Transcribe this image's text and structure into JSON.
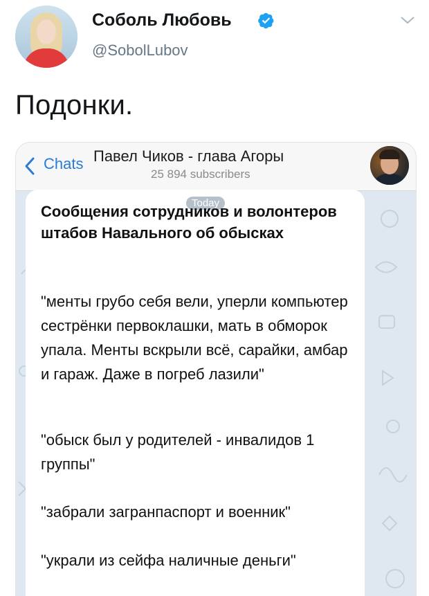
{
  "tweet": {
    "display_name": "Соболь Любовь",
    "handle": "@SobolLubov",
    "text": "Подонки.",
    "verified": true
  },
  "telegram": {
    "back_label": "Chats",
    "channel_title": "Павел Чиков - глава Агоры",
    "subscribers": "25 894 subscribers",
    "date_pill": "Today",
    "message": {
      "title": "Сообщения сотрудников и волонтеров штабов Навального об обысках",
      "paragraphs": [
        "\"менты грубо себя вели, уперли компьютер сестрёнки первоклашки, мать в обморок упала. Менты вскрыли всё, сарайки, амбар и гараж. Даже в погреб лазили\"",
        "\"обыск был у родителей - инвалидов 1 группы\"",
        "\"забрали загранпаспорт и военник\"",
        "\"украли из сейфа наличные деньги\""
      ]
    }
  },
  "colors": {
    "verified_badge": "#1da1f2",
    "telegram_link": "#2a7bd4",
    "chat_background": "#dfe8f0"
  },
  "icons": {
    "verified": "verified-badge-icon",
    "caret": "chevron-down-icon",
    "back": "chevron-left-icon"
  }
}
